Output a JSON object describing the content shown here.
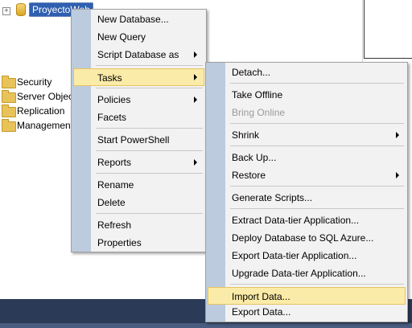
{
  "tree": {
    "expander_symbol": "+",
    "database_name": "ProyectoWeb",
    "folders": [
      "Security",
      "Server Objec",
      "Replication",
      "Managemen"
    ]
  },
  "context_menu": {
    "items": [
      {
        "label": "New Database...",
        "submenu": false
      },
      {
        "label": "New Query",
        "submenu": false
      },
      {
        "label": "Script Database as",
        "submenu": true
      },
      {
        "label": "Tasks",
        "submenu": true,
        "highlighted": true
      },
      {
        "label": "Policies",
        "submenu": true
      },
      {
        "label": "Facets",
        "submenu": false
      },
      {
        "label": "Start PowerShell",
        "submenu": false
      },
      {
        "label": "Reports",
        "submenu": true
      },
      {
        "label": "Rename",
        "submenu": false
      },
      {
        "label": "Delete",
        "submenu": false
      },
      {
        "label": "Refresh",
        "submenu": false
      },
      {
        "label": "Properties",
        "submenu": false
      }
    ]
  },
  "tasks_submenu": {
    "items": [
      {
        "label": "Detach...",
        "submenu": false
      },
      {
        "label": "Take Offline",
        "submenu": false
      },
      {
        "label": "Bring Online",
        "submenu": false,
        "disabled": true
      },
      {
        "label": "Shrink",
        "submenu": true
      },
      {
        "label": "Back Up...",
        "submenu": false
      },
      {
        "label": "Restore",
        "submenu": true
      },
      {
        "label": "Generate Scripts...",
        "submenu": false
      },
      {
        "label": "Extract Data-tier Application...",
        "submenu": false
      },
      {
        "label": "Deploy Database to SQL Azure...",
        "submenu": false
      },
      {
        "label": "Export Data-tier Application...",
        "submenu": false
      },
      {
        "label": "Upgrade Data-tier Application...",
        "submenu": false
      },
      {
        "label": "Import Data...",
        "submenu": false,
        "highlighted": true
      },
      {
        "label": "Export Data...",
        "submenu": false
      }
    ]
  },
  "colors": {
    "menu_background": "#f2f2f2",
    "menu_gutter": "#bccbdd",
    "highlight": "#fbeba8",
    "highlight_border": "#e5c365",
    "selection": "#2f5fb0",
    "taskbar": "#2b3a57"
  },
  "icons": {
    "database": "database-icon",
    "folder": "folder-icon",
    "submenu_arrow": "chevron-right-icon"
  }
}
